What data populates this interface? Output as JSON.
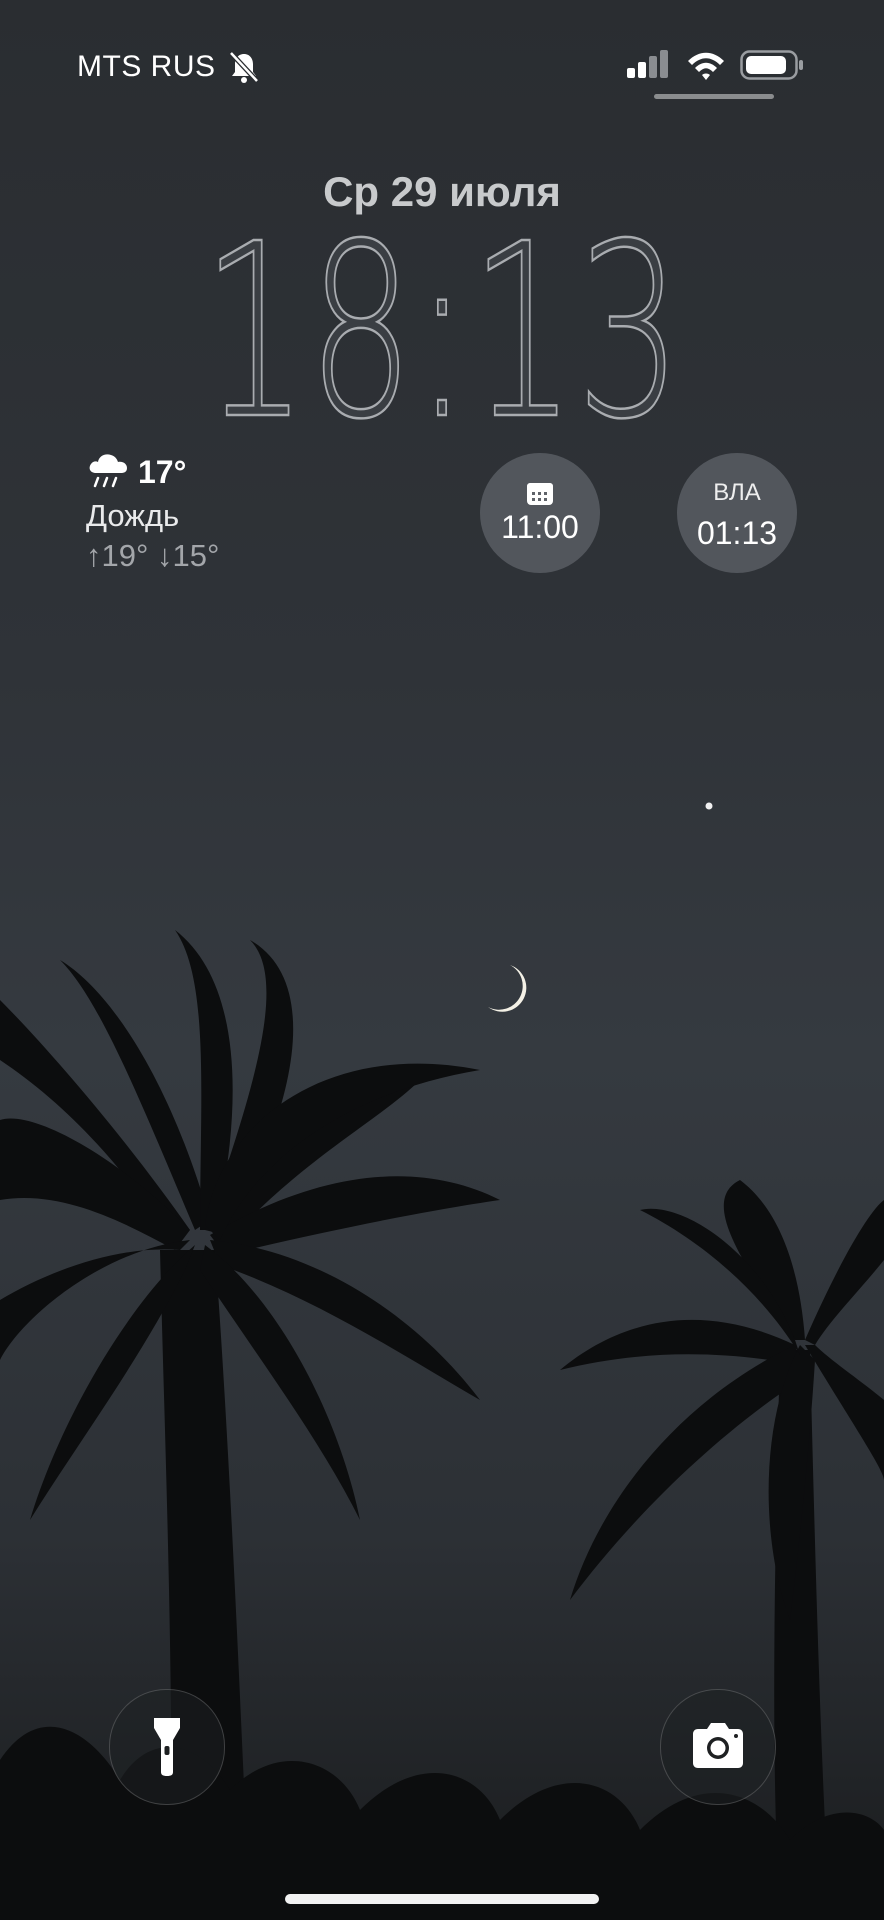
{
  "status_bar": {
    "carrier": "MTS RUS",
    "icons": [
      "bell-slash-icon",
      "cellular-signal-icon",
      "wifi-icon",
      "battery-icon"
    ]
  },
  "lock_screen": {
    "date": "Ср 29 июля",
    "time": "18:13"
  },
  "weather": {
    "icon": "cloud-rain-icon",
    "temperature": "17°",
    "condition": "Дождь",
    "range": "↑19° ↓15°"
  },
  "widgets": {
    "calendar": {
      "icon": "calendar-icon",
      "time": "11:00"
    },
    "world_clock": {
      "city": "ВЛА",
      "time": "01:13"
    }
  },
  "controls": {
    "flashlight": "flashlight-icon",
    "camera": "camera-icon"
  },
  "colors": {
    "sky_top": "#2a2d31",
    "sky_mid": "#353a40",
    "widget_bg": "#5f6369",
    "moon": "#f4f1e6"
  }
}
